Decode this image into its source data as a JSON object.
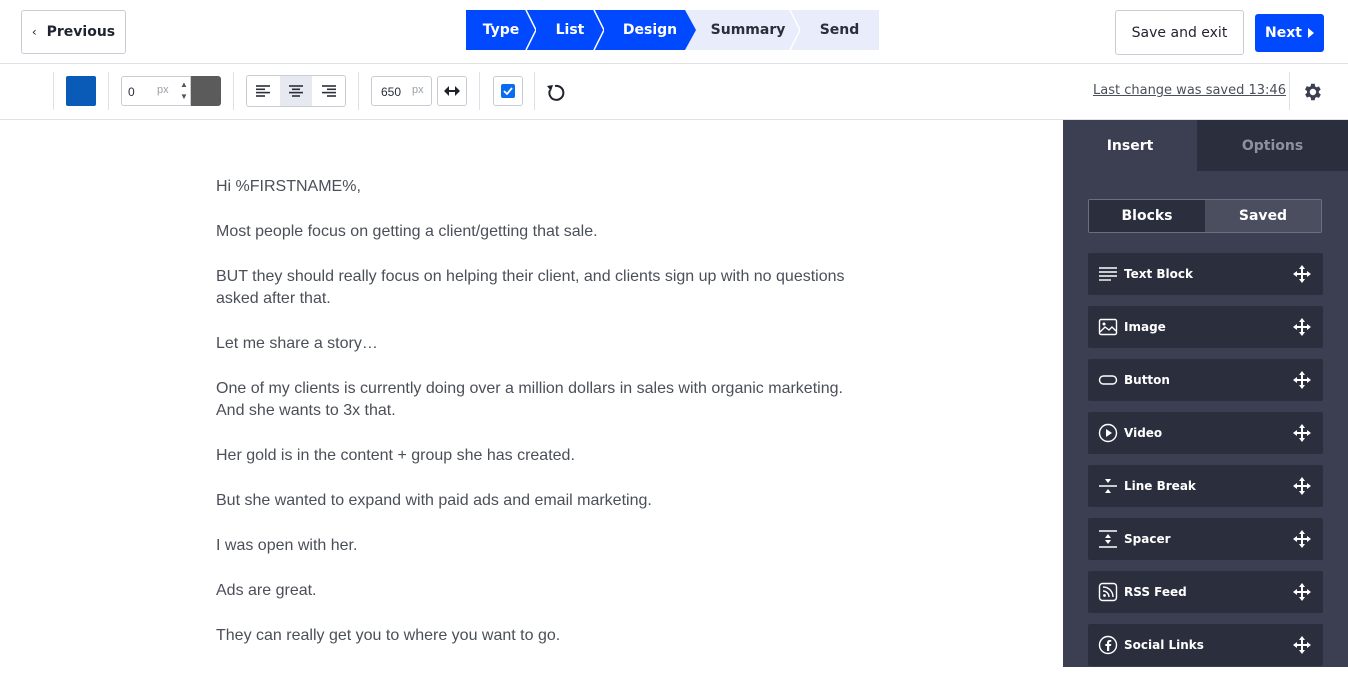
{
  "header": {
    "previous_label": "Previous",
    "steps": [
      {
        "label": "Type",
        "state": "done"
      },
      {
        "label": "List",
        "state": "done"
      },
      {
        "label": "Design",
        "state": "current"
      },
      {
        "label": "Summary",
        "state": "pending"
      },
      {
        "label": "Send",
        "state": "pending"
      }
    ],
    "save_exit_label": "Save and exit",
    "next_label": "Next"
  },
  "toolbar": {
    "background_color": "#0a5bb8",
    "border_width_value": "0",
    "border_width_unit": "px",
    "border_color": "#5b5b5b",
    "alignment": "center",
    "content_width_value": "650",
    "content_width_unit": "px",
    "checkbox_checked": true,
    "last_saved_text": "Last change was saved 13:46"
  },
  "email": {
    "paragraphs": [
      "Hi %FIRSTNAME%,",
      "Most people focus on getting a client/getting that sale.",
      "BUT they should really focus on helping their client, and clients sign up with no questions asked after that.",
      "Let me share a story…",
      "One of my clients is currently doing over a million dollars in sales with organic marketing. And she wants to 3x that.",
      "Her gold is in the content + group she has created.",
      "But she wanted to expand with paid ads and email marketing.",
      "I was open with her.",
      "Ads are great.",
      "They can really get you to where you want to go."
    ]
  },
  "sidebar": {
    "tabs": [
      {
        "label": "Insert",
        "active": true
      },
      {
        "label": "Options",
        "active": false
      }
    ],
    "segments": [
      {
        "label": "Blocks",
        "active": true
      },
      {
        "label": "Saved",
        "active": false
      }
    ],
    "blocks": [
      {
        "label": "Text Block",
        "icon": "text-block-icon"
      },
      {
        "label": "Image",
        "icon": "image-icon"
      },
      {
        "label": "Button",
        "icon": "button-icon"
      },
      {
        "label": "Video",
        "icon": "video-icon"
      },
      {
        "label": "Line Break",
        "icon": "line-break-icon"
      },
      {
        "label": "Spacer",
        "icon": "spacer-icon"
      },
      {
        "label": "RSS Feed",
        "icon": "rss-feed-icon"
      },
      {
        "label": "Social Links",
        "icon": "social-links-icon"
      }
    ]
  },
  "colors": {
    "accent": "#0049ff",
    "sidebar_bg": "#3b3f51",
    "block_bg": "#2b2f3d"
  }
}
